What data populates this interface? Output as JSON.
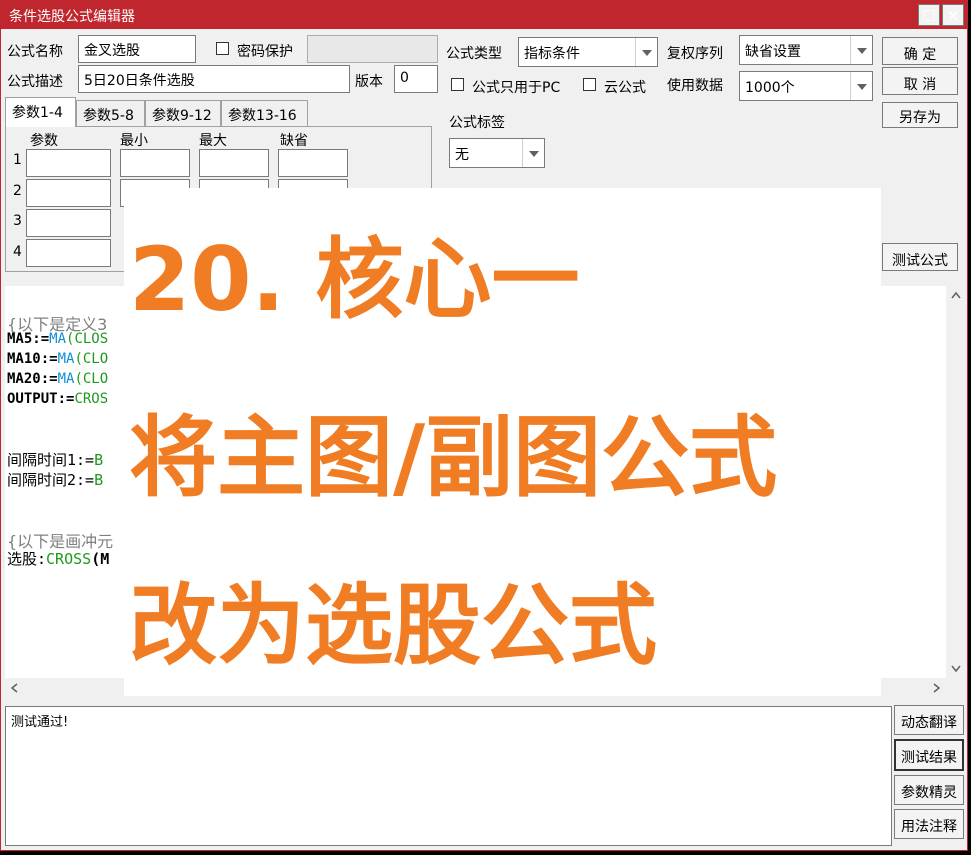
{
  "window": {
    "title": "条件选股公式编辑器",
    "maximize_glyph": "☐",
    "close_glyph": "✕"
  },
  "form": {
    "name_label": "公式名称",
    "name_value": "金叉选股",
    "password_label": "密码保护",
    "desc_label": "公式描述",
    "desc_value": "5日20日条件选股",
    "version_label": "版本",
    "version_value": "0",
    "type_label": "公式类型",
    "type_value": "指标条件",
    "pc_only_label": "公式只用于PC",
    "cloud_label": "云公式",
    "fq_label": "复权序列",
    "fq_value": "缺省设置",
    "data_label": "使用数据",
    "data_value": "1000个",
    "tag_label": "公式标签",
    "tag_value": "无"
  },
  "buttons": {
    "ok": "确 定",
    "cancel": "取 消",
    "save_as": "另存为",
    "test": "测试公式",
    "dyn": "动态翻译",
    "result": "测试结果",
    "param": "参数精灵",
    "usage": "用法注释"
  },
  "tabs": [
    "参数1-4",
    "参数5-8",
    "参数9-12",
    "参数13-16"
  ],
  "params": {
    "headers": [
      "参数",
      "最小",
      "最大",
      "缺省"
    ],
    "rows": [
      "1",
      "2",
      "3",
      "4"
    ]
  },
  "code": {
    "line1": "{以下是定义3",
    "line2a": "MA5:=",
    "line2b": "MA",
    "line2c": "(CLOS",
    "line3a": "MA10:=",
    "line3b": "MA",
    "line3c": "(CLO",
    "line4a": "MA20:=",
    "line4b": "MA",
    "line4c": "(CLO",
    "line5a": "OUTPUT:=",
    "line5b": "CROS",
    "line6a": "间隔时间1:=",
    "line6b": "B",
    "line7a": "间隔时间2:=",
    "line7b": "B",
    "line8": "{以下是画冲元",
    "line9a": "选股:",
    "line9b": "CROSS",
    "line9c": "(M"
  },
  "output": {
    "text": "测试通过!"
  },
  "overlay": {
    "line1": "20. 核心一",
    "line2": "将主图/副图公式",
    "line3": "改为选股公式",
    "color": "#f07c23"
  }
}
